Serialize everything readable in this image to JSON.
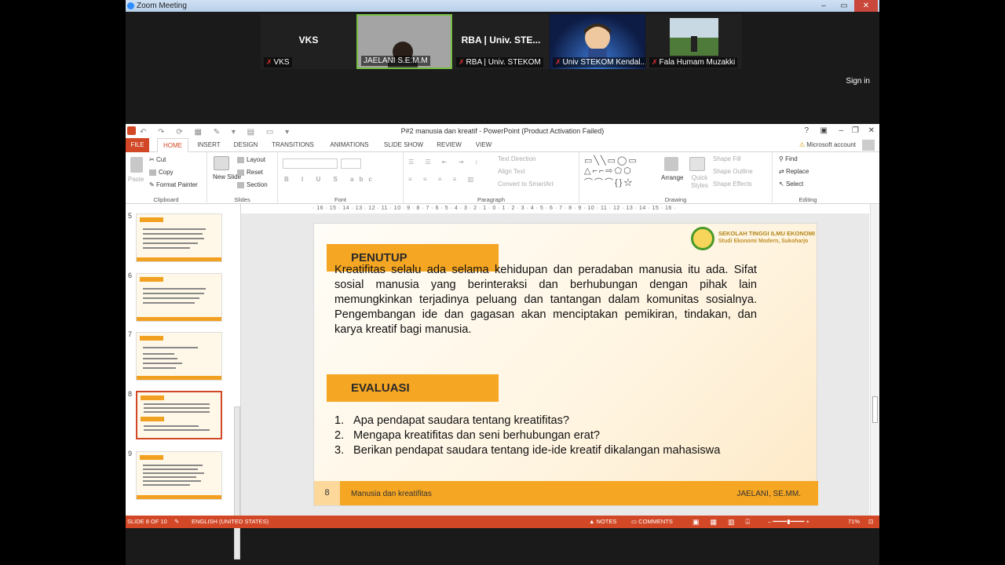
{
  "zoom": {
    "title": "Zoom Meeting",
    "sign_in": "Sign in",
    "participants": [
      {
        "name_large": "VKS",
        "label": "VKS"
      },
      {
        "name_large": "",
        "label": "JAELANI S.E.M.M"
      },
      {
        "name_large": "RBA | Univ. STE...",
        "label": "RBA | Univ. STEKOM"
      },
      {
        "name_large": "",
        "label": "Univ STEKOM Kendal..."
      },
      {
        "name_large": "",
        "label": "Fala Humam Muzakki"
      }
    ]
  },
  "ppt": {
    "window_title": "P#2 manusia dan kreatif - PowerPoint (Product Activation Failed)",
    "tabs": [
      "FILE",
      "HOME",
      "INSERT",
      "DESIGN",
      "TRANSITIONS",
      "ANIMATIONS",
      "SLIDE SHOW",
      "REVIEW",
      "VIEW"
    ],
    "account": "Microsoft account",
    "ribbon": {
      "clipboard": {
        "label": "Clipboard",
        "paste": "Paste",
        "cut": "Cut",
        "copy": "Copy",
        "format_painter": "Format Painter"
      },
      "slides": {
        "label": "Slides",
        "new_slide": "New Slide",
        "layout": "Layout",
        "reset": "Reset",
        "section": "Section"
      },
      "font": {
        "label": "Font"
      },
      "paragraph": {
        "label": "Paragraph",
        "text_direction": "Text Direction",
        "align_text": "Align Text",
        "smartart": "Convert to SmartArt"
      },
      "drawing": {
        "label": "Drawing",
        "arrange": "Arrange",
        "quick_styles": "Quick Styles",
        "shape_fill": "Shape Fill",
        "shape_outline": "Shape Outline",
        "shape_effects": "Shape Effects"
      },
      "editing": {
        "label": "Editing",
        "find": "Find",
        "replace": "Replace",
        "select": "Select"
      }
    },
    "ruler": "· 16 · 15 · 14 · 13 · 12 · 11 · 10 · 9 · 8 · 7 · 6 · 5 · 4 · 3 · 2 · 1 · 0 · 1 · 2 · 3 · 4 · 5 · 6 · 7 · 8 · 9 · 10 · 11 · 12 · 13 · 14 · 15 · 16 ·",
    "vruler": [
      "9",
      "8",
      "7",
      "6",
      "5",
      "4",
      "3",
      "2",
      "1",
      "0",
      "1",
      "2",
      "3",
      "4",
      "5",
      "6",
      "7",
      "8",
      "9"
    ],
    "thumbnails": [
      "5",
      "6",
      "7",
      "8",
      "9"
    ],
    "slide": {
      "heading1": "PENUTUP",
      "logo_line1": "SEKOLAH TINGGI ILMU EKONOMI",
      "logo_line2": "Studi Ekonomi Modern, Sukoharjo",
      "paragraph": "Kreatifitas selalu ada selama kehidupan dan peradaban manusia itu ada. Sifat sosial manusia yang berinteraksi dan berhubungan dengan pihak lain memungkinkan terjadinya peluang dan tantangan dalam komunitas sosialnya. Pengembangan ide dan gagasan akan menciptakan pemikiran, tindakan, dan karya kreatif bagi manusia.",
      "heading2": "EVALUASI",
      "questions": [
        {
          "num": "1.",
          "text": "Apa pendapat saudara tentang kreatifitas?"
        },
        {
          "num": "2.",
          "text": "Mengapa kreatifitas dan seni berhubungan erat?"
        },
        {
          "num": "3.",
          "text": "Berikan pendapat saudara tentang ide-ide kreatif dikalangan mahasiswa"
        }
      ],
      "slide_number": "8",
      "footer_title": "Manusia dan kreatifitas",
      "footer_author": "JAELANI, SE.MM."
    },
    "status": {
      "slide_of": "SLIDE 8 OF 10",
      "language": "ENGLISH (UNITED STATES)",
      "notes": "NOTES",
      "comments": "COMMENTS",
      "zoom": "71%"
    }
  }
}
